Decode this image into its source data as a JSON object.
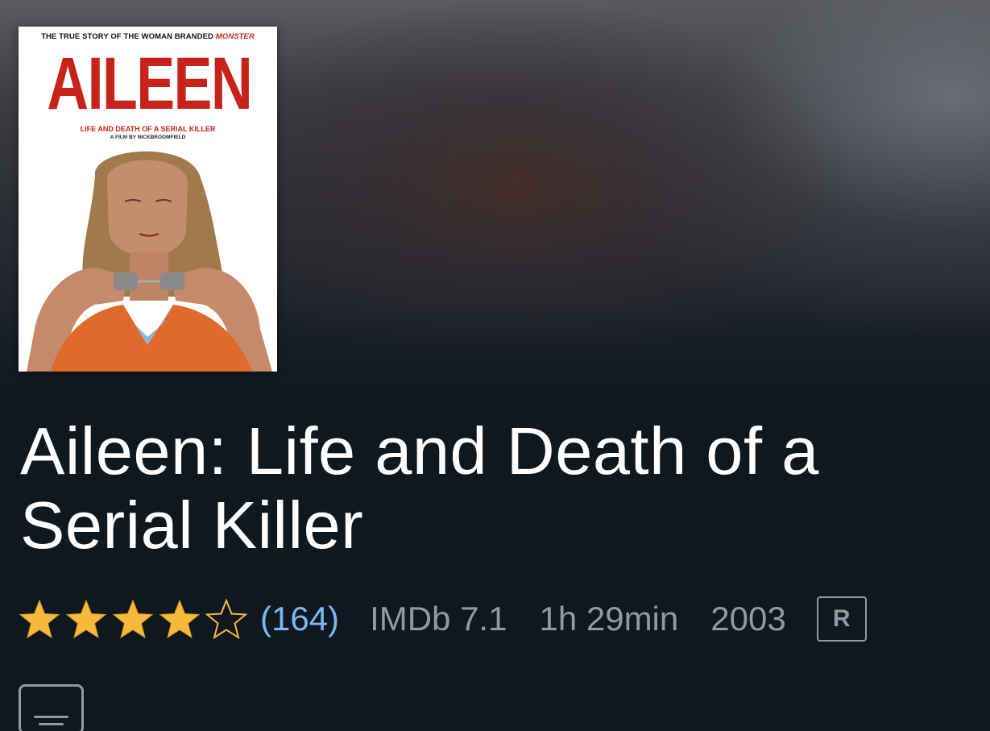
{
  "poster": {
    "tagline_prefix": "THE TRUE STORY OF THE WOMAN BRANDED",
    "tagline_highlight": "MONSTER",
    "title": "AILEEN",
    "subtitle": "LIFE AND DEATH OF A SERIAL KILLER",
    "credit": "A FILM BY NICKBROOMFIELD"
  },
  "title": "Aileen: Life and Death of a Serial Killer",
  "rating": {
    "stars": 4,
    "max_stars": 5,
    "count": "(164)"
  },
  "imdb": "IMDb 7.1",
  "duration": "1h 29min",
  "year": "2003",
  "maturity_rating": "R",
  "colors": {
    "star_fill": "#f6b93b",
    "rating_count": "#79b8f3",
    "meta_text": "#8e9aa6",
    "background": "#0f171f"
  }
}
